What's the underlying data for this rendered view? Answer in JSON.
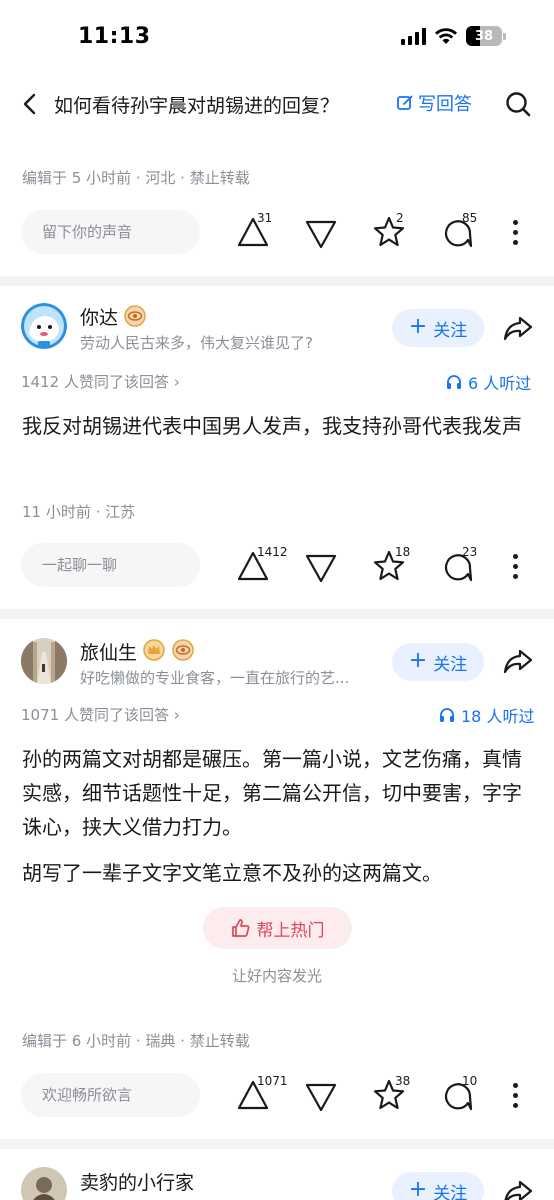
{
  "status_bar": {
    "time": "11:13",
    "battery": "38"
  },
  "nav": {
    "title": "如何看待孙宇晨对胡锡进的回复？",
    "write_label": "写回答"
  },
  "prev_answer": {
    "meta": "编辑于 5 小时前 · 河北 · 禁止转载",
    "comment_placeholder": "留下你的声音",
    "upvotes": "31",
    "favorites": "2",
    "comments": "85"
  },
  "answers": [
    {
      "author": "你达",
      "bio": "劳动人民古来多，伟大复兴谁见了?",
      "follow_label": "关注",
      "vote_summary": "1412 人赞同了该回答 ›",
      "listen_label": "6 人听过",
      "paragraphs": [
        "我反对胡锡进代表中国男人发声，我支持孙哥代表我发声"
      ],
      "meta": "11 小时前 · 江苏",
      "comment_placeholder": "一起聊一聊",
      "upvotes": "1412",
      "favorites": "18",
      "comments": "23"
    },
    {
      "author": "旅仙生",
      "bio": "好吃懒做的专业食客，一直在旅行的艺...",
      "follow_label": "关注",
      "vote_summary": "1071 人赞同了该回答 ›",
      "listen_label": "18 人听过",
      "paragraphs": [
        "孙的两篇文对胡都是碾压。第一篇小说，文艺伤痛，真情实感，细节话题性十足，第二篇公开信，切中要害，字字诛心，挟大义借力打力。",
        "胡写了一辈子文字文笔立意不及孙的这两篇文。"
      ],
      "hot_label": "帮上热门",
      "hot_caption": "让好内容发光",
      "meta": "编辑于 6 小时前 · 瑞典 · 禁止转载",
      "comment_placeholder": "欢迎畅所欲言",
      "upvotes": "1071",
      "favorites": "38",
      "comments": "10"
    },
    {
      "author": "卖豹的小行家",
      "follow_label": "关注"
    }
  ],
  "colors": {
    "accent": "#1772f6",
    "hot": "#e0455c",
    "muted": "#8a8f99",
    "badge_gold": "#e8a23d"
  },
  "icons": [
    "back-icon",
    "edit-icon",
    "search-icon",
    "upvote-icon",
    "downvote-icon",
    "star-icon",
    "comment-icon",
    "more-icon",
    "share-icon",
    "headphones-icon",
    "thumbs-up-icon",
    "crown-icon",
    "eye-badge-icon"
  ]
}
